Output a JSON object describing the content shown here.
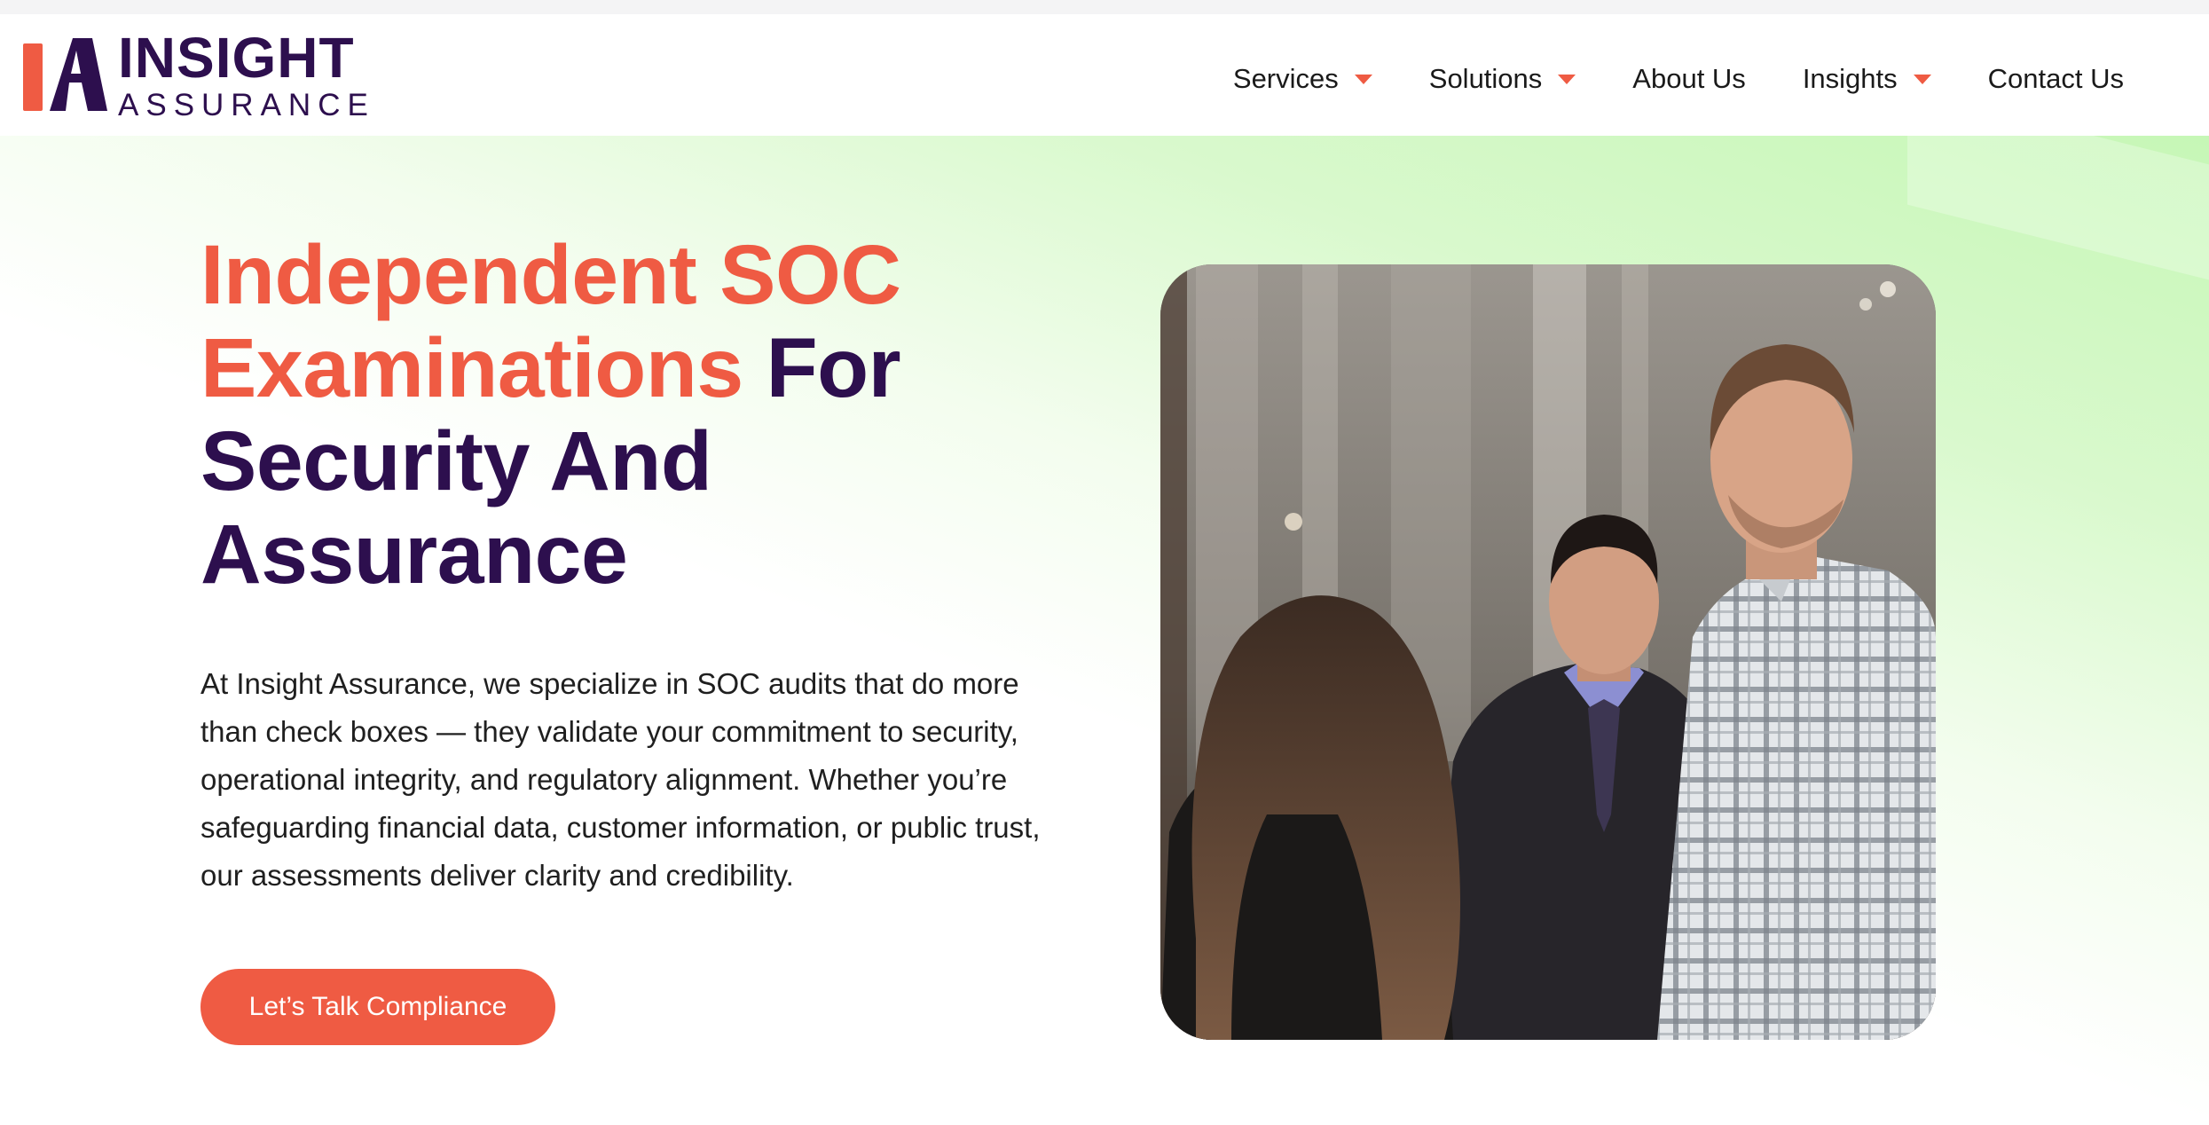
{
  "brand": {
    "logo_top": "INSIGHT",
    "logo_bottom": "ASSURANCE",
    "colors": {
      "primary_dark": "#2d0f4e",
      "accent": "#ef5b43",
      "hero_green": "#c6f7b6"
    }
  },
  "nav": {
    "items": [
      {
        "label": "Services",
        "has_dropdown": true
      },
      {
        "label": "Solutions",
        "has_dropdown": true
      },
      {
        "label": "About Us",
        "has_dropdown": false
      },
      {
        "label": "Insights",
        "has_dropdown": true
      },
      {
        "label": "Contact Us",
        "has_dropdown": false
      }
    ],
    "dropdown_icon": "caret-down-icon"
  },
  "hero": {
    "headline_accent": "Independent SOC Examinations",
    "headline_rest": "For Security And Assurance",
    "body": "At Insight Assurance, we specialize in SOC audits that do more than check boxes — they validate your commitment to security, operational integrity, and regulatory alignment. Whether you’re safeguarding financial data, customer information, or public trust, our assessments deliver clarity and credibility.",
    "cta_label": "Let’s Talk Compliance"
  }
}
